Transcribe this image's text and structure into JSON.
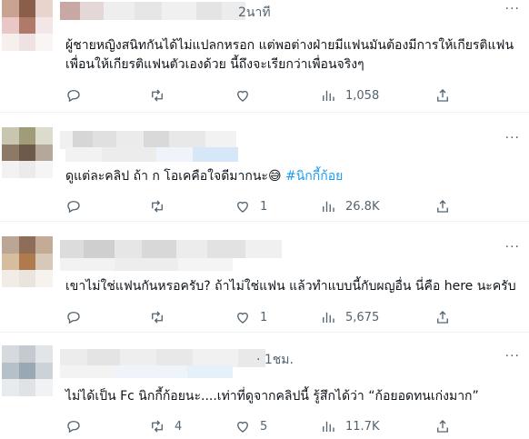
{
  "tweets": [
    {
      "time": "2นาที",
      "text_lines": [
        "ผู้ชายหญิงสนิทกันได้ไม่แปลกหรอก แต่พอต่างฝ่ายมีแฟนมันต้องมีการให้เกียรติแฟน",
        "เพื่อนให้เกียรติแฟนตัวเองด้วย นี้ถึงจะเรียกว่าเพื่อนจริงๆ"
      ],
      "replies": "",
      "retweets": "",
      "likes": "",
      "views": "1,058"
    },
    {
      "time": "",
      "text": "ดูแต่ละคลิป ถ้า ก โอเคคือใจดีมากนะ😅 ",
      "hashtag": "#นิกกี้ก้อย",
      "replies": "",
      "retweets": "",
      "likes": "1",
      "views": "26.8K"
    },
    {
      "time": "",
      "text": "เขาไม่ใช่แฟนกันหรอครับ? ถ้าไม่ใช่แฟน แล้วทำแบบนี้กับผญอื่น นี่คือ here นะครับ",
      "replies": "",
      "retweets": "",
      "likes": "1",
      "views": "5,675"
    },
    {
      "time": "· 1ชม.",
      "text": "ไม่ได้เป็น Fc นิกกี้ก้อยนะ....เท่าที่ดูจากคลิปนี้ รู้สึกได้ว่า “ก้อยอดทนเก่งมาก”",
      "replies": "",
      "retweets": "4",
      "likes": "5",
      "views": "11.7K"
    }
  ],
  "icons": [
    "reply-icon",
    "retweet-icon",
    "like-icon",
    "views-icon",
    "share-icon",
    "more-icon"
  ],
  "colors": {
    "text": "#0f1419",
    "muted": "#536471",
    "accent": "#1d9bf0",
    "divider": "#eff3f4"
  }
}
